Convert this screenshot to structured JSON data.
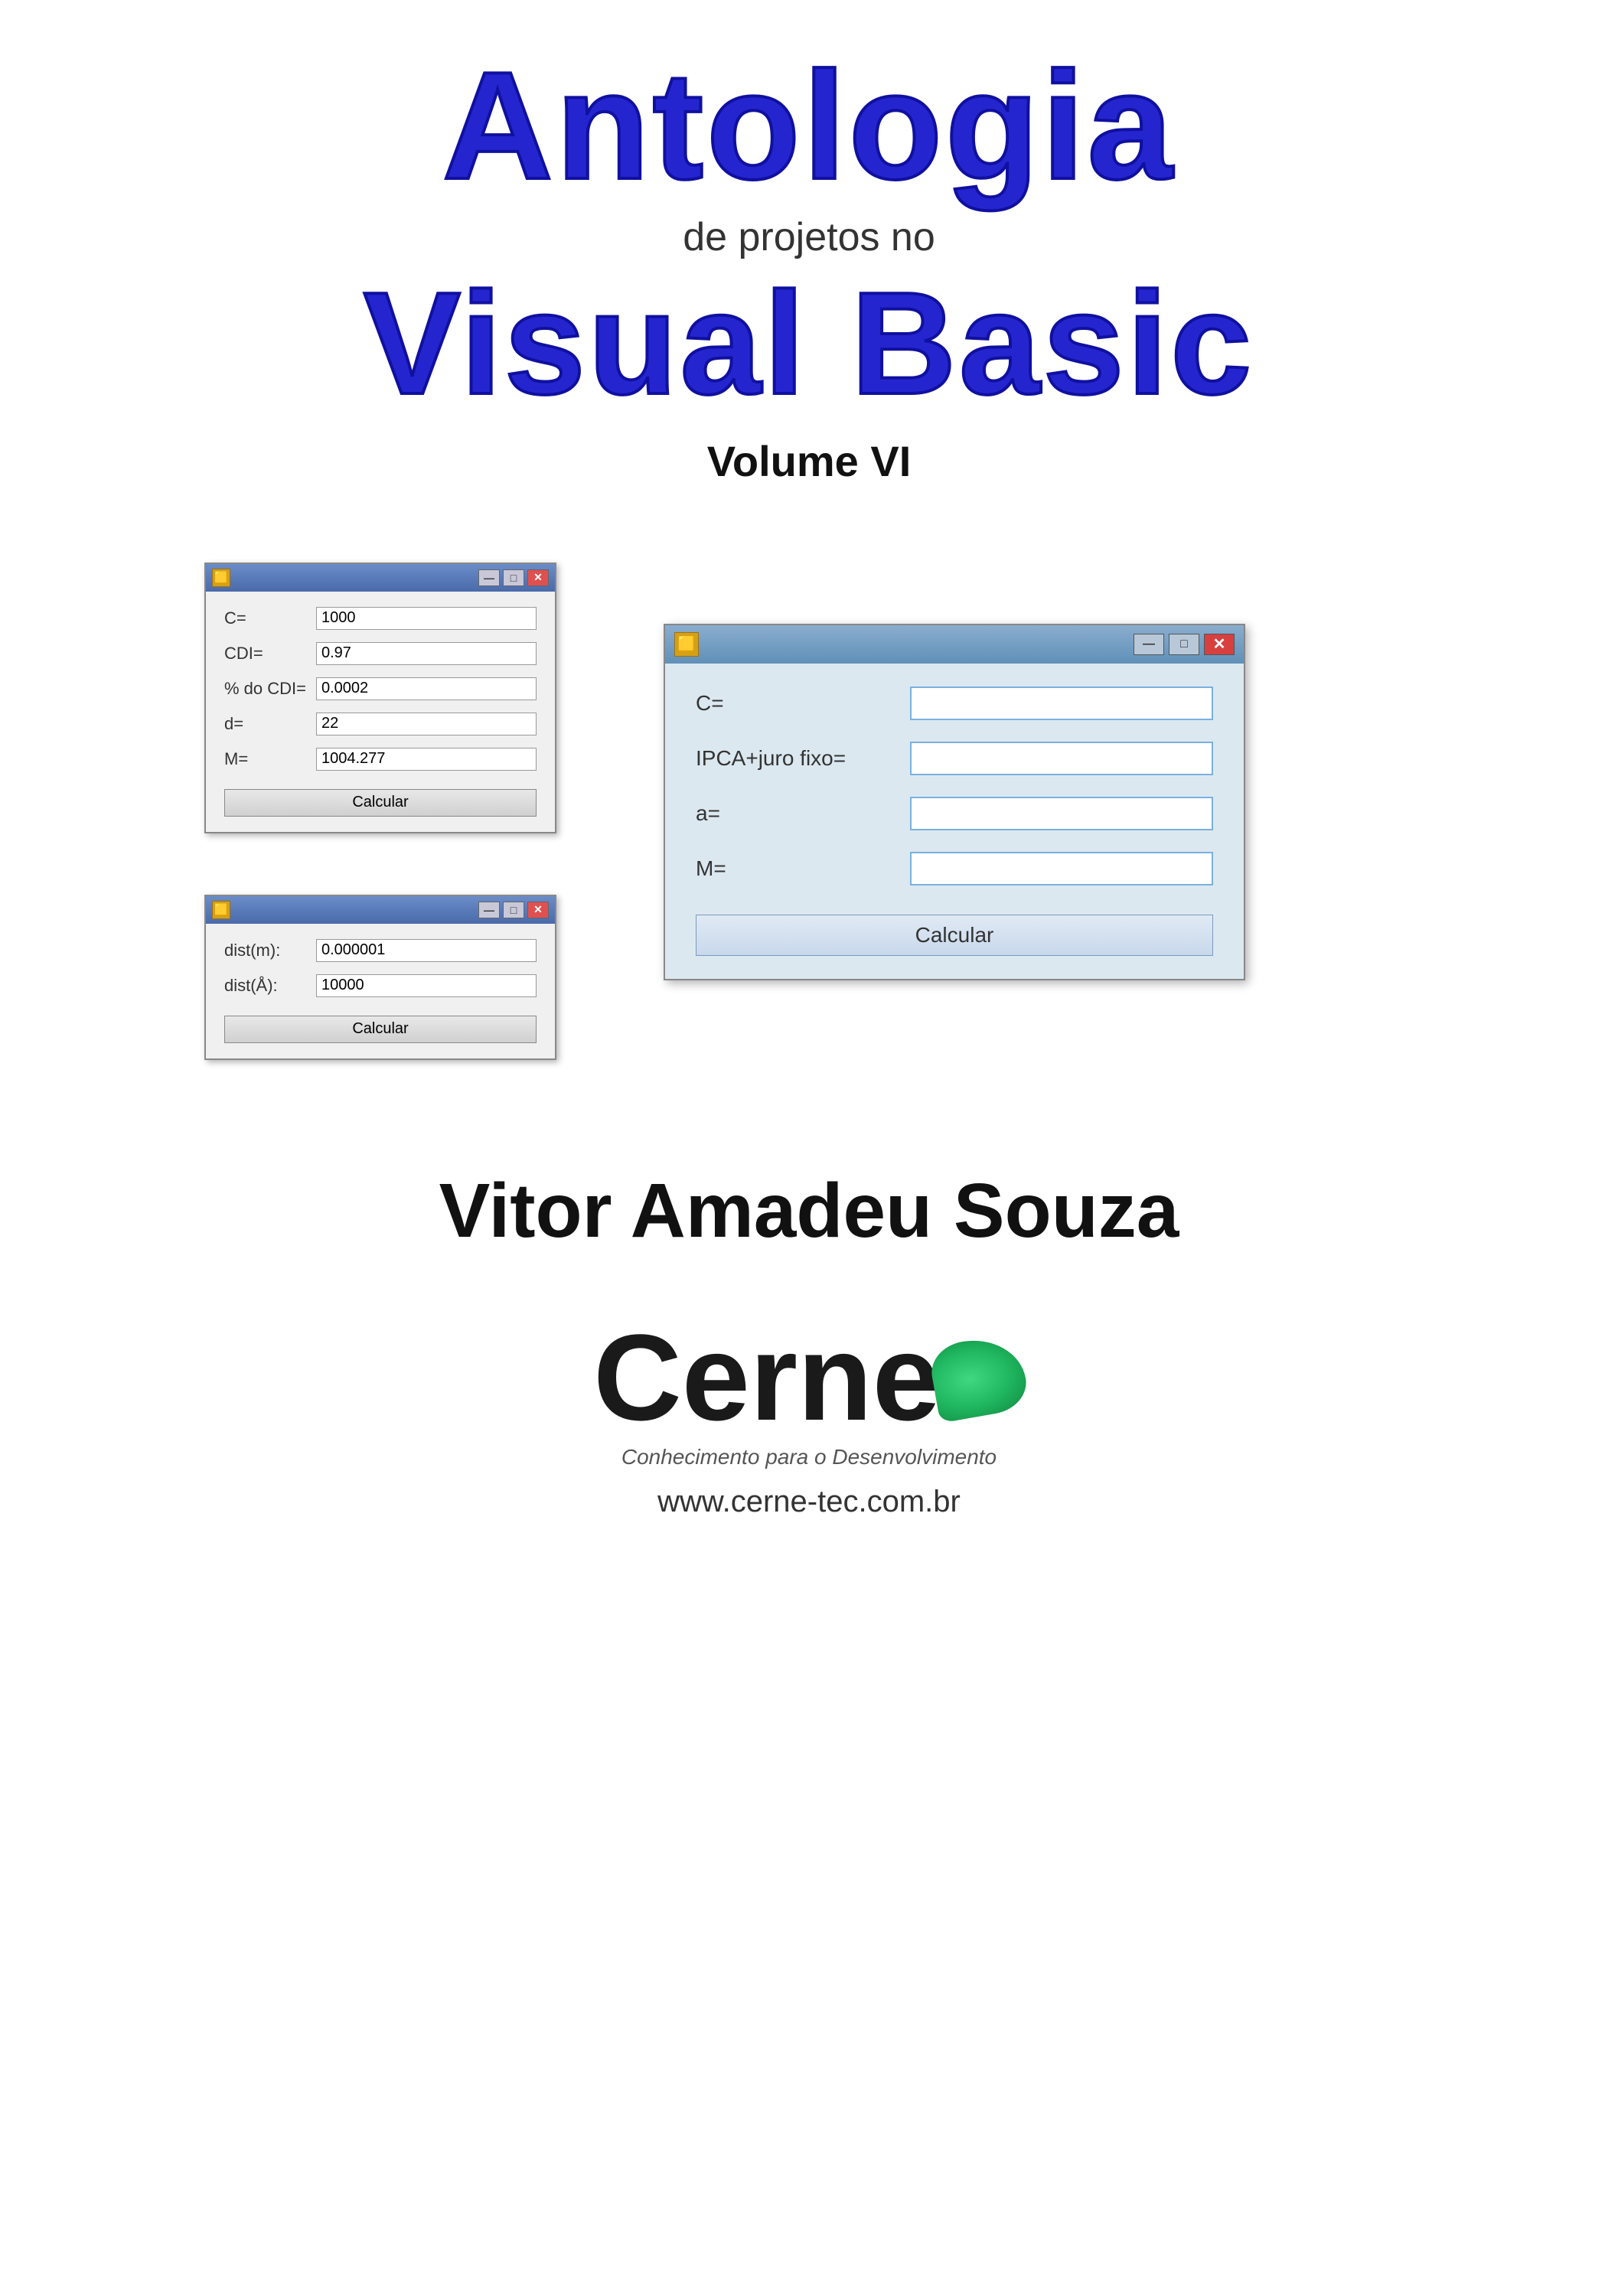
{
  "title": {
    "antologia": "Antologia",
    "subtitle": "de projetos no",
    "visual_basic": "Visual Basic",
    "volume": "Volume VI"
  },
  "window_small_1": {
    "titlebar_icon": "🟡",
    "btn_min": "—",
    "btn_max": "□",
    "btn_close": "✕",
    "fields": [
      {
        "label": "C=",
        "value": "1000"
      },
      {
        "label": "CDI=",
        "value": "0.97"
      },
      {
        "label": "% do CDI=",
        "value": "0.0002"
      },
      {
        "label": "d=",
        "value": "22"
      },
      {
        "label": "M=",
        "value": "1004.277"
      }
    ],
    "calcular": "Calcular"
  },
  "window_small_2": {
    "titlebar_icon": "🟡",
    "btn_min": "—",
    "btn_max": "□",
    "btn_close": "✕",
    "fields": [
      {
        "label": "dist(m):",
        "value": "0.000001"
      },
      {
        "label": "dist(Å):",
        "value": "10000"
      }
    ],
    "calcular": "Calcular"
  },
  "window_large": {
    "titlebar_icon": "🟡",
    "btn_min": "—",
    "btn_max": "□",
    "btn_close": "✕",
    "fields": [
      {
        "label": "C=",
        "value": ""
      },
      {
        "label": "IPCA+juro fixo=",
        "value": ""
      },
      {
        "label": "a=",
        "value": ""
      },
      {
        "label": "M=",
        "value": ""
      }
    ],
    "calcular": "Calcular"
  },
  "author": {
    "name": "Vitor Amadeu Souza"
  },
  "cerne": {
    "logo_text": "Cerne",
    "tagline": "Conhecimento para o Desenvolvimento",
    "url": "www.cerne-tec.com.br"
  }
}
